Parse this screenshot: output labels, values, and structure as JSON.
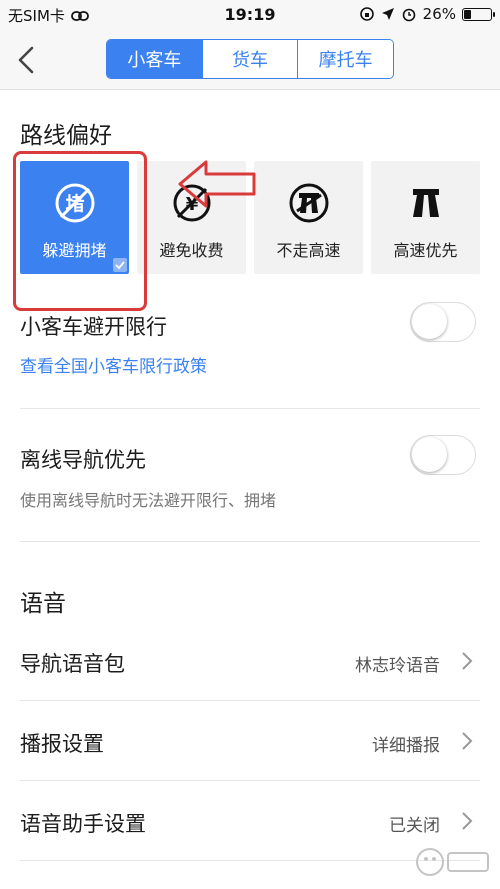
{
  "status_bar": {
    "carrier": "无SIM卡",
    "time": "19:19",
    "battery": "26%",
    "battery_level": 0.26
  },
  "nav": {
    "tabs": [
      {
        "label": "小客车",
        "active": true
      },
      {
        "label": "货车",
        "active": false
      },
      {
        "label": "摩托车",
        "active": false
      }
    ]
  },
  "route_pref": {
    "title": "路线偏好",
    "options": [
      {
        "label": "躲避拥堵",
        "icon": "avoid-congestion-icon",
        "active": true
      },
      {
        "label": "避免收费",
        "icon": "avoid-toll-icon",
        "active": false
      },
      {
        "label": "不走高速",
        "icon": "no-highway-icon",
        "active": false
      },
      {
        "label": "高速优先",
        "icon": "highway-priority-icon",
        "active": false
      }
    ]
  },
  "restriction": {
    "title": "小客车避开限行",
    "link": "查看全国小客车限行政策",
    "enabled": false
  },
  "offline": {
    "title": "离线导航优先",
    "desc": "使用离线导航时无法避开限行、拥堵",
    "enabled": false
  },
  "voice": {
    "title": "语音",
    "items": [
      {
        "label": "导航语音包",
        "value": "林志玲语音"
      },
      {
        "label": "播报设置",
        "value": "详细播报"
      },
      {
        "label": "语音助手设置",
        "value": "已关闭"
      }
    ]
  },
  "colors": {
    "accent": "#3b82f0",
    "highlight_red": "#d93a3a"
  }
}
